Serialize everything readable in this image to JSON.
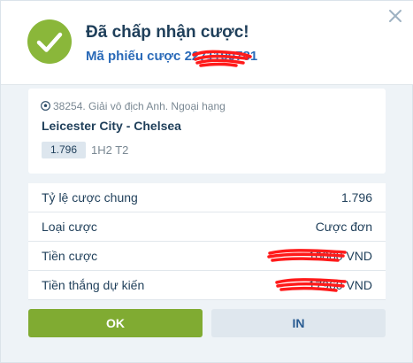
{
  "header": {
    "title": "Đã chấp nhận cược!",
    "ticket_label": "Mã phiếu cược",
    "ticket_number": "2271190781",
    "status_icon": "checkmark-icon",
    "close_icon": "close-icon"
  },
  "event": {
    "league": "38254. Giải vô địch Anh. Ngoại hạng",
    "league_icon": "soccer-ball-icon",
    "teams": "Leicester City - Chelsea",
    "odd": "1.796",
    "market": "1H2 T2"
  },
  "summary": {
    "rows": [
      {
        "label": "Tỷ lệ cược chung",
        "value": "1.796"
      },
      {
        "label": "Loại cược",
        "value": "Cược đơn"
      },
      {
        "label": "Tiền cược",
        "value": "10000 VND"
      },
      {
        "label": "Tiền thắng dự kiến",
        "value": "17960 VND"
      }
    ]
  },
  "buttons": {
    "ok": "OK",
    "print": "IN"
  },
  "colors": {
    "accent_green": "#80ab32",
    "title_navy": "#1f3f5a",
    "link_blue": "#2a6ab8",
    "redaction_red": "#ff1a1a"
  }
}
